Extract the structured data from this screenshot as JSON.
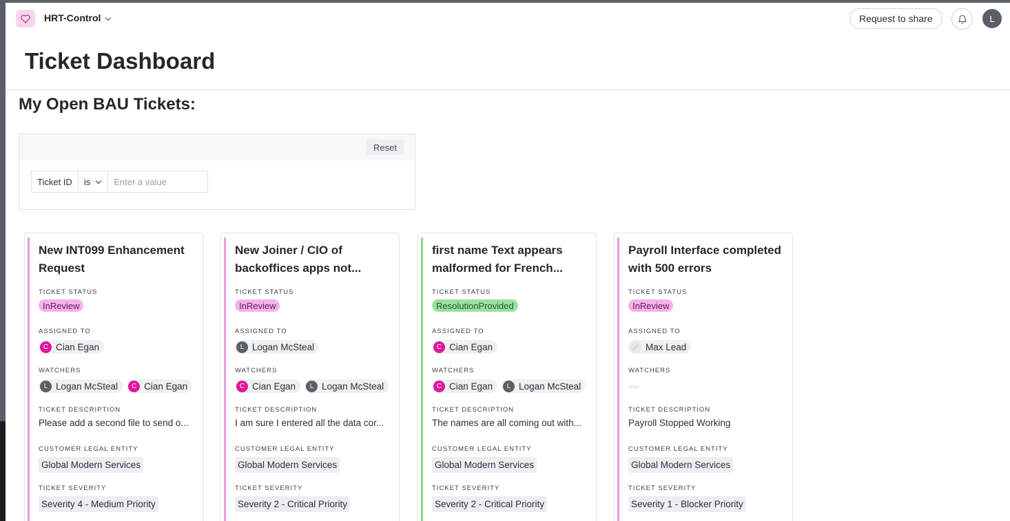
{
  "app": {
    "name": "HRT-Control",
    "share_label": "Request to share",
    "user_initial": "L"
  },
  "page": {
    "title": "Ticket Dashboard",
    "section_title": "My Open BAU Tickets:"
  },
  "filter": {
    "reset_label": "Reset",
    "field": "Ticket ID",
    "operator": "is",
    "placeholder": "Enter a value"
  },
  "labels": {
    "status": "TICKET STATUS",
    "assigned": "ASSIGNED TO",
    "watchers": "WATCHERS",
    "description": "TICKET DESCRIPTION",
    "entity": "CUSTOMER LEGAL ENTITY",
    "severity": "TICKET SEVERITY"
  },
  "colors": {
    "in_review_bg": "#f3b2ea",
    "resolution_bg": "#9fe0a2",
    "avatar_c": "#e0159a",
    "avatar_l": "#5b5f66"
  },
  "cards": [
    {
      "title": "New INT099 Enhancement Request",
      "status": "InReview",
      "assigned": {
        "initial": "C",
        "name": "Cian Egan"
      },
      "watchers": [
        {
          "initial": "L",
          "name": "Logan McSteal"
        },
        {
          "initial": "C",
          "name": "Cian Egan"
        }
      ],
      "description": "Please add a second file to send o...",
      "entity": "Global Modern Services",
      "severity": "Severity 4 - Medium Priority"
    },
    {
      "title": "New Joiner / CIO of backoffices apps not...",
      "status": "InReview",
      "assigned": {
        "initial": "L",
        "name": "Logan McSteal"
      },
      "watchers": [
        {
          "initial": "C",
          "name": "Cian Egan"
        },
        {
          "initial": "L",
          "name": "Logan McSteal"
        }
      ],
      "description": "I am sure I entered all the data cor...",
      "entity": "Global Modern Services",
      "severity": "Severity 2 - Critical Priority"
    },
    {
      "title": "first name Text appears malformed for French...",
      "status": "ResolutionProvided",
      "assigned": {
        "initial": "C",
        "name": "Cian Egan"
      },
      "watchers": [
        {
          "initial": "C",
          "name": "Cian Egan"
        },
        {
          "initial": "L",
          "name": "Logan McSteal"
        }
      ],
      "description": "The names are all coming out with...",
      "entity": "Global Modern Services",
      "severity": "Severity 2 - Critical Priority"
    },
    {
      "title": "Payroll Interface completed with 500 errors",
      "status": "InReview",
      "assigned": {
        "initial": "",
        "name": "Max Lead"
      },
      "watchers": [],
      "description": "Payroll Stopped Working",
      "entity": "Global Modern Services",
      "severity": "Severity 1 - Blocker Priority"
    }
  ]
}
